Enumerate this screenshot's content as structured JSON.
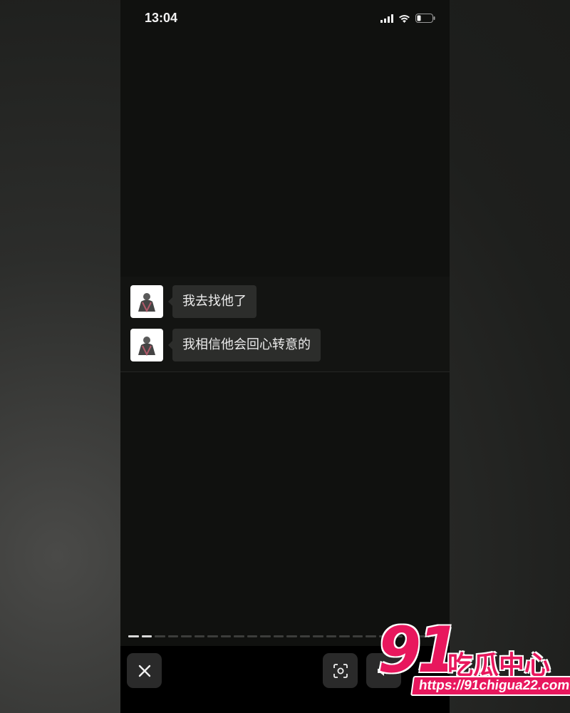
{
  "status_bar": {
    "time": "13:04",
    "icons": [
      "signal-icon",
      "wifi-icon",
      "battery-icon"
    ]
  },
  "chat": {
    "messages": [
      {
        "text": "我去找他了",
        "avatar": "avatar-icon"
      },
      {
        "text": "我相信他会回心转意的",
        "avatar": "avatar-icon"
      }
    ]
  },
  "progress": {
    "total_segments": 24,
    "completed_segments": 2
  },
  "bottom_bar": {
    "buttons": [
      "close-icon",
      "scan-icon",
      "speaker-icon"
    ]
  },
  "watermark": {
    "number": "91",
    "name": "吃瓜中心",
    "url": "https://91chigua22.com"
  },
  "colors": {
    "background": "#10110f",
    "bubble": "#2c2d2b",
    "watermark_accent": "#e8175d"
  }
}
